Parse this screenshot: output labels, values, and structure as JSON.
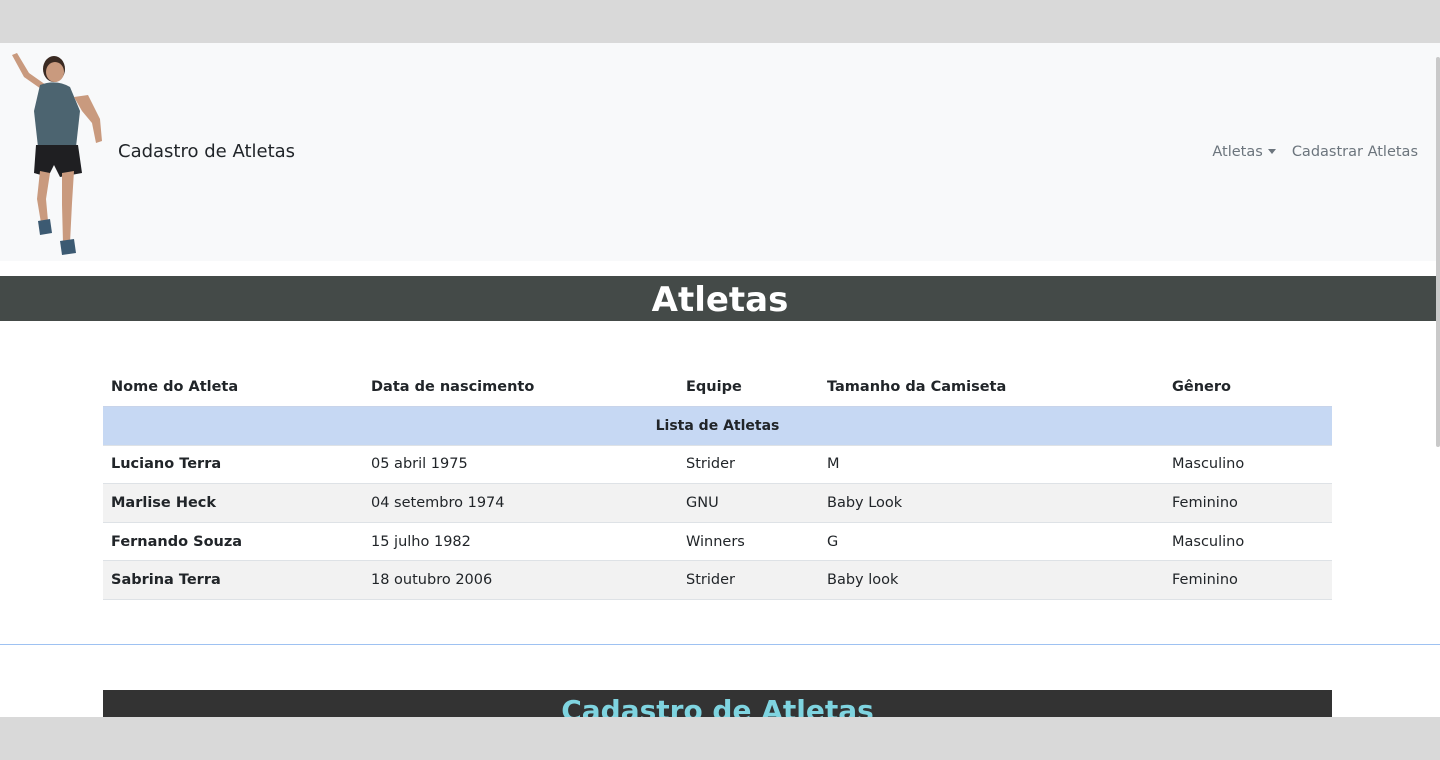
{
  "navbar": {
    "brand": "Cadastro de Atletas",
    "links": [
      {
        "label": "Atletas",
        "dropdown": true
      },
      {
        "label": "Cadastrar Atletas",
        "dropdown": false
      }
    ]
  },
  "section_title": "Atletas",
  "table": {
    "headers": [
      "Nome do Atleta",
      "Data de nascimento",
      "Equipe",
      "Tamanho da Camiseta",
      "Gênero"
    ],
    "caption": "Lista de Atletas",
    "rows": [
      [
        "Luciano Terra",
        "05 abril 1975",
        "Strider",
        "M",
        "Masculino"
      ],
      [
        "Marlise Heck",
        "04 setembro 1974",
        "GNU",
        "Baby Look",
        "Feminino"
      ],
      [
        "Fernando Souza",
        "15 julho 1982",
        "Winners",
        "G",
        "Masculino"
      ],
      [
        "Sabrina Terra",
        "18 outubro 2006",
        "Strider",
        "Baby look",
        "Feminino"
      ]
    ]
  },
  "form_title": "Cadastro de Atletas",
  "colors": {
    "navbar_bg": "#f8f9fa",
    "title_bar": "#444a48",
    "caption_row": "#c6d8f3",
    "form_header_bg": "#333333",
    "form_header_text": "#7fd4e0"
  },
  "icons": {
    "logo": "running-athlete-image",
    "dropdown": "caret-down-icon"
  }
}
